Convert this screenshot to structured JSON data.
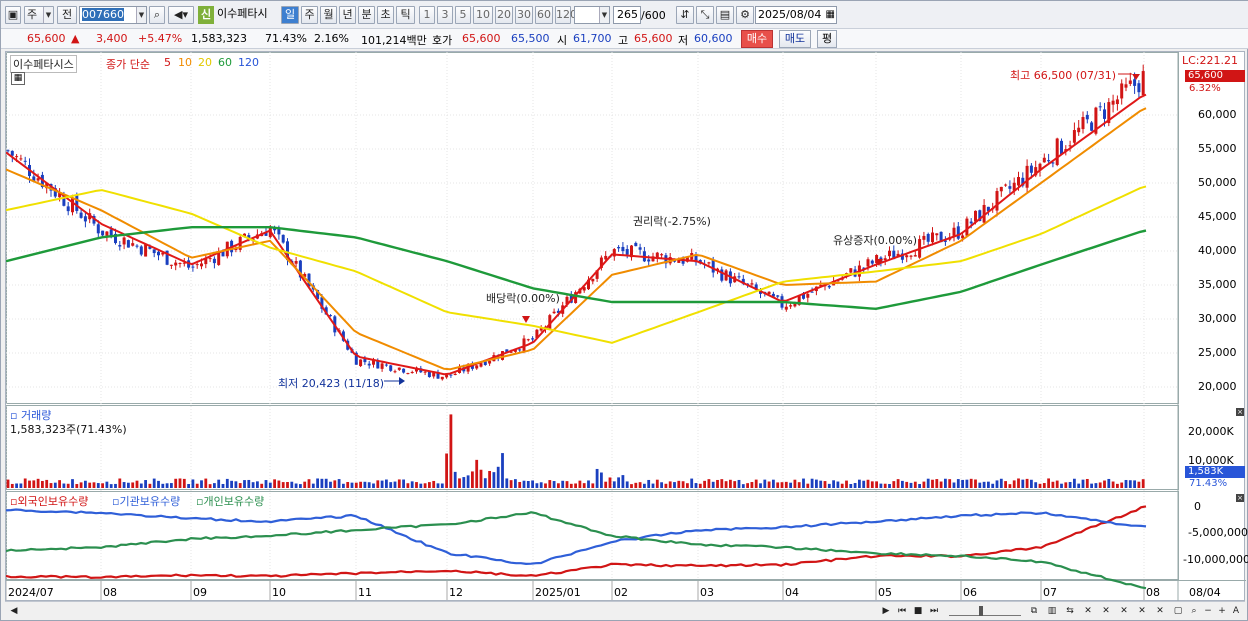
{
  "toolbar": {
    "mode_label": "주",
    "prev_label": "전",
    "code": "007660",
    "stock_badge": "신",
    "stock_name": "이수페타시",
    "periods": [
      "일",
      "주",
      "월",
      "년",
      "분",
      "초",
      "틱"
    ],
    "intervals": [
      "1",
      "3",
      "5",
      "10",
      "20",
      "30",
      "60",
      "120"
    ],
    "count": "265",
    "count_total": "/600",
    "date": "2025/08/04"
  },
  "quote": {
    "price": "65,600",
    "change": "3,400",
    "change_pct": "+5.47%",
    "volume": "1,583,323",
    "vol_ratio": "71.43%",
    "turnover": "2.16%",
    "amount": "101,214백만",
    "ask_label": "호가",
    "ask": "65,600",
    "bid": "65,500",
    "open_label": "시",
    "open": "61,700",
    "high_label": "고",
    "high": "65,600",
    "low_label": "저",
    "low": "60,600",
    "buy_label": "매수",
    "sell_label": "매도",
    "eval_label": "평"
  },
  "price_panel": {
    "stock_tag": "이수페타시스",
    "ma_label": "종가 단순",
    "ma_periods": [
      "5",
      "10",
      "20",
      "60",
      "120"
    ],
    "ma_colors": [
      "#e01818",
      "#f08c00",
      "#f0e000",
      "#1e9a3a",
      "#2855d8"
    ],
    "lc_label": "LC:221.21",
    "high_note": "최고 66,500 (07/31)",
    "low_note": "최저 20,423 (11/18)",
    "events": [
      "배당락(0.00%)",
      "권리락(-2.75%)",
      "유상증자(0.00%)"
    ],
    "last_price_tag": "65,600",
    "last_pct_tag": "6.32%",
    "y_ticks": [
      "60,000",
      "55,000",
      "50,000",
      "45,000",
      "40,000",
      "35,000",
      "30,000",
      "25,000",
      "20,000"
    ]
  },
  "volume_panel": {
    "title": "거래량",
    "info": "1,583,323주(71.43%)",
    "y_ticks": [
      "20,000K",
      "10,000K"
    ],
    "last_tag": "1,583K",
    "last_pct": "71.43%"
  },
  "holding_panel": {
    "series": [
      "외국인보유수량",
      "기관보유수량",
      "개인보유수량"
    ],
    "series_colors": [
      "#d11515",
      "#2f5fd8",
      "#2b8f4f"
    ],
    "y_ticks": [
      "0",
      "-5,000,000",
      "-10,000,000"
    ]
  },
  "x_axis": {
    "labels": [
      "2024/07",
      "08",
      "09",
      "10",
      "11",
      "12",
      "2025/01",
      "02",
      "03",
      "04",
      "05",
      "06",
      "07",
      "08"
    ],
    "end_label": "08/04"
  },
  "chart_data": [
    {
      "type": "line",
      "title": "",
      "x": [
        "2024/07",
        "08",
        "09",
        "10",
        "11",
        "12",
        "2025/01",
        "02",
        "03",
        "04",
        "05",
        "06",
        "07",
        "08"
      ],
      "ylim": [
        18000,
        67000
      ],
      "series": [
        {
          "name": "종가",
          "values": [
            55000,
            43000,
            37500,
            43500,
            24000,
            21500,
            27000,
            40000,
            38500,
            32000,
            38500,
            43000,
            53000,
            65600
          ]
        },
        {
          "name": "5",
          "values": [
            54500,
            44000,
            38000,
            43000,
            24500,
            21800,
            26500,
            39500,
            38500,
            32500,
            38000,
            42500,
            52000,
            63000
          ]
        },
        {
          "name": "20",
          "values": [
            52000,
            46000,
            39000,
            41500,
            28000,
            22500,
            25500,
            36500,
            39500,
            35000,
            35500,
            41500,
            50000,
            61000
          ]
        },
        {
          "name": "60",
          "values": [
            46000,
            49000,
            45500,
            40500,
            37000,
            31000,
            29000,
            26500,
            31000,
            35500,
            37000,
            38500,
            42500,
            49500
          ]
        },
        {
          "name": "120",
          "values": [
            38500,
            42000,
            43500,
            43500,
            42000,
            38500,
            34500,
            32500,
            32500,
            32500,
            31500,
            34000,
            38000,
            43000
          ]
        }
      ]
    },
    {
      "type": "bar",
      "title": "거래량",
      "x": [
        "2024/07",
        "08",
        "09",
        "10",
        "11",
        "12",
        "2025/01",
        "02",
        "03",
        "04",
        "05",
        "06",
        "07",
        "08"
      ],
      "ylim": [
        0,
        25000000
      ],
      "series": [
        {
          "name": "거래량",
          "values": [
            1200000,
            1100000,
            900000,
            1000000,
            1500000,
            2500000,
            1800000,
            2200000,
            1500000,
            1300000,
            1600000,
            1400000,
            1700000,
            1583323
          ]
        }
      ]
    },
    {
      "type": "line",
      "title": "",
      "x": [
        "2024/07",
        "08",
        "09",
        "10",
        "11",
        "12",
        "2025/01",
        "02",
        "03",
        "04",
        "05",
        "06",
        "07",
        "08"
      ],
      "ylim": [
        -13000000,
        1500000
      ],
      "series": [
        {
          "name": "외국인보유수량",
          "values": [
            -12000000,
            -12200000,
            -11800000,
            -12000000,
            -11500000,
            -11000000,
            -12000000,
            -10000000,
            -10200000,
            -10000000,
            -8500000,
            -8500000,
            -7000000,
            0
          ]
        },
        {
          "name": "기관보유수량",
          "values": [
            -500000,
            -1000000,
            -2000000,
            -2500000,
            -1500000,
            -8000000,
            -10000000,
            -6000000,
            -4000000,
            -3500000,
            -2500000,
            -1500000,
            -1000000,
            -3500000
          ]
        },
        {
          "name": "개인보유수량",
          "values": [
            -7500000,
            -7000000,
            -5500000,
            -5000000,
            -4000000,
            -3000000,
            -1000000,
            -5000000,
            -6500000,
            -7000000,
            -8000000,
            -8500000,
            -9500000,
            -14000000
          ]
        }
      ]
    }
  ]
}
